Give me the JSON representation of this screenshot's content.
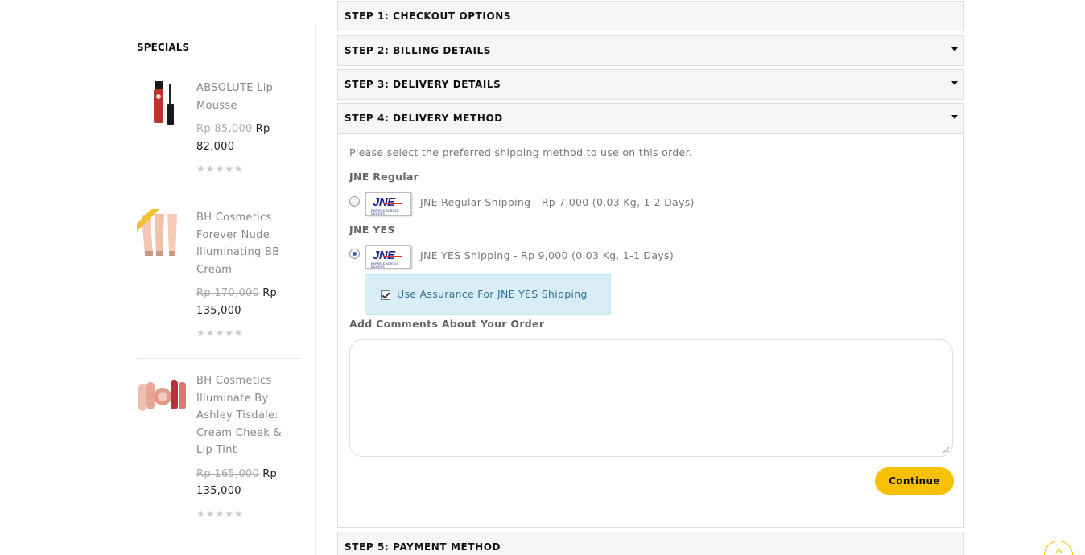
{
  "sidebar": {
    "title": "SPECIALS",
    "products": [
      {
        "name": "ABSOLUTE Lip Mousse",
        "old_price": "Rp 85,000",
        "price": "Rp 82,000",
        "stars": "★★★★★"
      },
      {
        "name": "BH Cosmetics Forever Nude Illuminating BB Cream",
        "old_price": "Rp 170,000",
        "price": "Rp 135,000",
        "stars": "★★★★★"
      },
      {
        "name": "BH Cosmetics Illuminate By Ashley Tisdale: Cream Cheek & Lip Tint",
        "old_price": "Rp 165,000",
        "price": "Rp 135,000",
        "stars": "★★★★★"
      }
    ]
  },
  "steps": [
    {
      "title": "STEP 1: CHECKOUT OPTIONS"
    },
    {
      "title": "STEP 2: BILLING DETAILS"
    },
    {
      "title": "STEP 3: DELIVERY DETAILS"
    },
    {
      "title": "STEP 4: DELIVERY METHOD"
    },
    {
      "title": "STEP 5: PAYMENT METHOD"
    }
  ],
  "delivery": {
    "intro": "Please select the preferred shipping method to use on this order.",
    "groups": [
      {
        "title": "JNE Regular",
        "option": "JNE Regular Shipping - Rp 7,000 (0.03 Kg, 1-2 Days)",
        "selected": false
      },
      {
        "title": "JNE YES",
        "option": "JNE YES Shipping - Rp 9,000 (0.03 Kg, 1-1 Days)",
        "selected": true
      }
    ],
    "logo": {
      "mark": "JNE",
      "sub": "EXPRESS ACROSS NATIONS"
    },
    "assurance_label": "Use Assurance For JNE YES Shipping",
    "assurance_checked": true,
    "comments_title": "Add Comments About Your Order",
    "comments_value": "",
    "continue_label": "Continue"
  },
  "colors": {
    "accent": "#f7c000",
    "info_bg": "#d9edf7",
    "info_text": "#31708f",
    "panel_bg": "#f6f6f6"
  },
  "icons": {
    "caret": "caret-down-icon",
    "scroll_top": "chevron-up-icon"
  }
}
